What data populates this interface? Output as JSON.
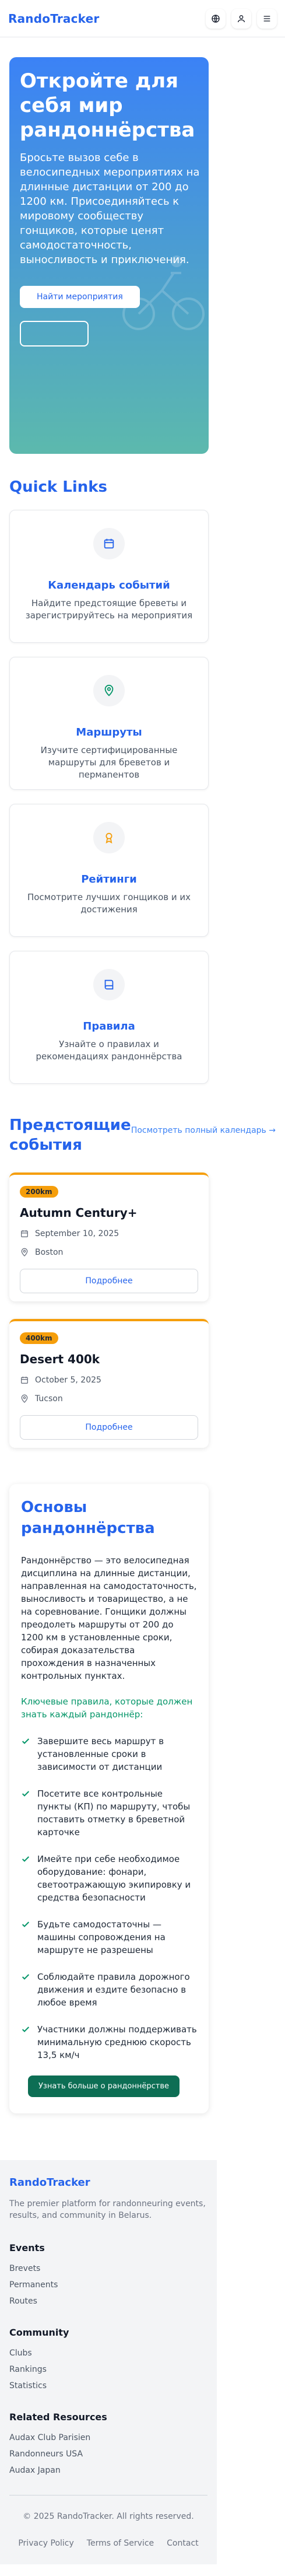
{
  "header": {
    "brand": "RandoTracker"
  },
  "hero": {
    "title": "Откройте для себя мир рандоннёрства",
    "subtitle": "Бросьте вызов себе в велосипедных мероприятиях на длинные дистанции от 200 до 1200 км. Присоединяйтесь к мировому сообществу гонщиков, которые ценят самодостаточность, выносливость и приключения.",
    "primary_button": "Найти мероприятия",
    "secondary_button": ""
  },
  "quick_links": {
    "title": "Quick Links",
    "cards": [
      {
        "icon": "calendar-icon",
        "title": "Календарь событий",
        "desc": "Найдите предстоящие бреветы и зарегистрируйтесь на мероприятия"
      },
      {
        "icon": "map-pin-icon",
        "title": "Маршруты",
        "desc": "Изучите сертифицированные маршруты для бреветов и пермanентов"
      },
      {
        "icon": "award-icon",
        "title": "Рейтинги",
        "desc": "Посмотрите лучших гонщиков и их достижения"
      },
      {
        "icon": "book-icon",
        "title": "Правила",
        "desc": "Узнайте о правилах и рекомендациях рандоннёрства"
      }
    ]
  },
  "upcoming": {
    "title": "Предстоящие события",
    "view_all": "Посмотреть полный календарь →",
    "events": [
      {
        "distance": "200km",
        "name": "Autumn Century+",
        "date": "September 10, 2025",
        "location": "Boston",
        "button": "Подробнее"
      },
      {
        "distance": "400km",
        "name": "Desert 400k",
        "date": "October 5, 2025",
        "location": "Tucson",
        "button": "Подробнее"
      }
    ]
  },
  "basics": {
    "title": "Основы рандоннёрства",
    "text": "Рандоннёрство — это велосипедная дисциплина на длинные дистанции, направленная на самодостаточность, выносливость и товарищество, а не на соревнование. Гонщики должны преодолеть маршруты от 200 до 1200 км в установленные сроки, собирая доказательства прохождения в назначенных контрольных пунктах.",
    "lead": "Ключевые правила, которые должен знать каждый рандоннёр:",
    "rules": [
      "Завершите весь маршрут в установленные сроки в зависимости от дистанции",
      "Посетите все контрольные пункты (КП) по маршруту, чтобы поставить отметку в бреветной карточке",
      "Имейте при себе необходимое оборудование: фонари, светоотражающую экипировку и средства безопасности",
      "Будьте самодостаточны — машины сопровождения на маршруте не разрешены",
      "Соблюдайте правила дорожного движения и ездите безопасно в любое время",
      "Участники должны поддерживать минимальную среднюю скорость 13,5 км/ч"
    ],
    "button": "Узнать больше о рандоннёрстве"
  },
  "footer": {
    "brand": "RandoTracker",
    "tagline": "The premier platform for randonneuring events, results, and community in Belarus.",
    "events_heading": "Events",
    "events_links": [
      "Brevets",
      "Permanents",
      "Routes"
    ],
    "community_heading": "Community",
    "community_links": [
      "Clubs",
      "Rankings",
      "Statistics"
    ],
    "related_heading": "Related Resources",
    "related_links": [
      "Audax Club Parisien",
      "Randonneurs USA",
      "Audax Japan"
    ],
    "copyright": "© 2025 RandoTracker. All rights reserved.",
    "bottom_links": [
      "Privacy Policy",
      "Terms of Service",
      "Contact"
    ]
  },
  "colors": {
    "brand": "#2563eb",
    "accent_orange": "#f59e0b",
    "accent_green": "#059669",
    "button_green": "#0d6e54"
  }
}
